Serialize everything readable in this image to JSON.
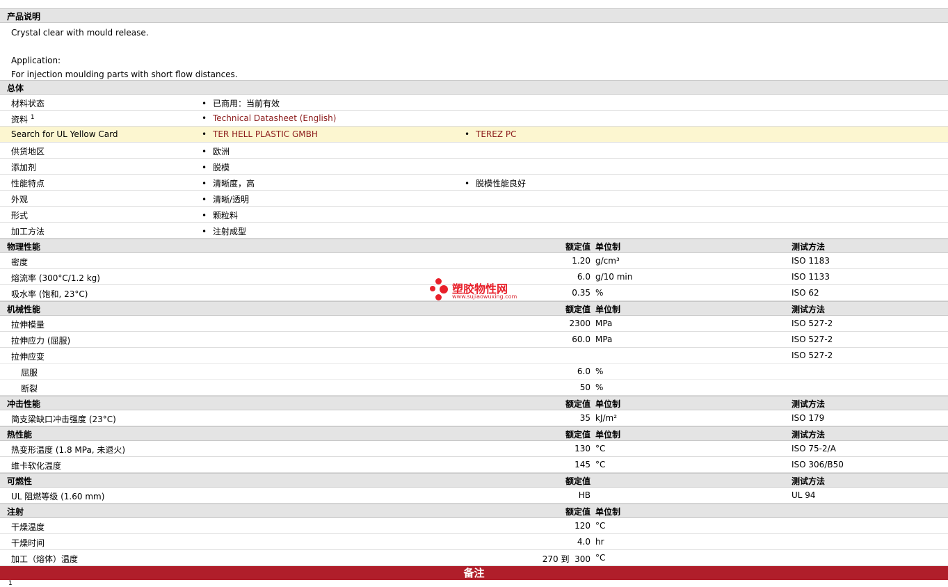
{
  "description": {
    "header": "产品说明",
    "line1": "Crystal clear with mould release.",
    "line2": "Application:",
    "line3": "For injection moulding parts with short flow distances."
  },
  "general": {
    "header": "总体",
    "rows": [
      {
        "label": "材料状态",
        "v1": "已商用：当前有效",
        "v2": ""
      },
      {
        "label": "资料",
        "sup": "1",
        "v1": "Technical Datasheet (English)",
        "v2": ""
      },
      {
        "label": "Search for UL Yellow Card",
        "v1": "TER HELL PLASTIC GMBH",
        "v2": "TEREZ PC"
      },
      {
        "label": "供货地区",
        "v1": "欧洲",
        "v2": ""
      },
      {
        "label": "添加剂",
        "v1": "脱模",
        "v2": ""
      },
      {
        "label": "性能特点",
        "v1": "清晰度，高",
        "v2": "脱模性能良好"
      },
      {
        "label": "外观",
        "v1": "清晰/透明",
        "v2": ""
      },
      {
        "label": "形式",
        "v1": "颗粒料",
        "v2": ""
      },
      {
        "label": "加工方法",
        "v1": "注射成型",
        "v2": ""
      }
    ]
  },
  "col_headers": {
    "value": "额定值",
    "unit": "单位制",
    "method": "测试方法"
  },
  "physical": {
    "header": "物理性能",
    "rows": [
      {
        "label": "密度",
        "value": "1.20",
        "unit": "g/cm³",
        "method": "ISO 1183"
      },
      {
        "label": "熔流率 (300°C/1.2 kg)",
        "value": "6.0",
        "unit": "g/10 min",
        "method": "ISO 1133"
      },
      {
        "label": "吸水率 (饱和, 23°C)",
        "value": "0.35",
        "unit": "%",
        "method": "ISO 62"
      }
    ]
  },
  "mechanical": {
    "header": "机械性能",
    "rows": [
      {
        "label": "拉伸模量",
        "value": "2300",
        "unit": "MPa",
        "method": "ISO 527-2"
      },
      {
        "label": "拉伸应力 (屈服)",
        "value": "60.0",
        "unit": "MPa",
        "method": "ISO 527-2"
      },
      {
        "label": "拉伸应变",
        "value": "",
        "unit": "",
        "method": "ISO 527-2"
      },
      {
        "label": "屈服",
        "value": "6.0",
        "unit": "%",
        "method": ""
      },
      {
        "label": "断裂",
        "value": "50",
        "unit": "%",
        "method": ""
      }
    ]
  },
  "impact": {
    "header": "冲击性能",
    "rows": [
      {
        "label": "简支梁缺口冲击强度 (23°C)",
        "value": "35",
        "unit": "kJ/m²",
        "method": "ISO 179"
      }
    ]
  },
  "thermal": {
    "header": "热性能",
    "rows": [
      {
        "label": "热变形温度 (1.8 MPa, 未退火)",
        "value": "130",
        "unit": "°C",
        "method": "ISO 75-2/A"
      },
      {
        "label": "维卡软化温度",
        "value": "145",
        "unit": "°C",
        "method": "ISO 306/B50"
      }
    ]
  },
  "flammability": {
    "header": "可燃性",
    "rows": [
      {
        "label": "UL 阻燃等级 (1.60 mm)",
        "value": "HB",
        "unit": "",
        "method": "UL 94"
      }
    ]
  },
  "injection": {
    "header": "注射",
    "rows": [
      {
        "label": "干燥温度",
        "value": "120",
        "unit": "°C"
      },
      {
        "label": "干燥时间",
        "value": "4.0",
        "unit": "hr"
      },
      {
        "label": "加工（熔体）温度",
        "value": "270 到  300",
        "unit": "°C"
      }
    ]
  },
  "notes": {
    "header": "备注",
    "footnote": "1"
  },
  "watermark": {
    "title": "塑胶物性网",
    "url": "www.sujiaowuxing.com"
  },
  "colors": {
    "link": "#8b1a1a",
    "notes_bar": "#b01e2a",
    "watermark": "#e8202a",
    "highlight_row": "#fcf6d0"
  }
}
